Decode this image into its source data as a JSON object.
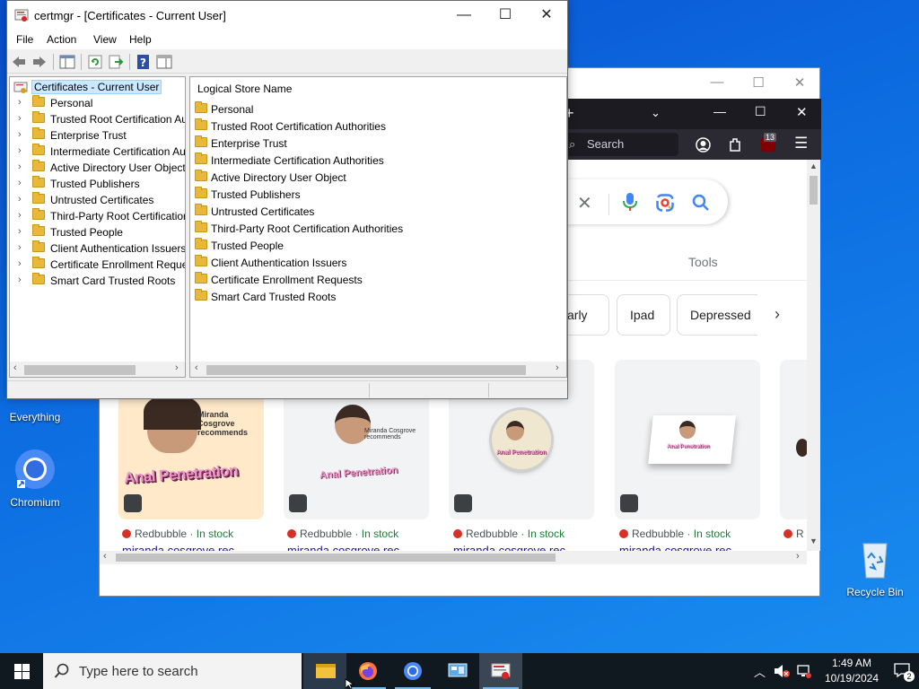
{
  "colors": {
    "desktop": "#0c6be0",
    "taskbar": "#101820",
    "selection": "#cce8ff",
    "folder": "#e8b83a"
  },
  "desktop": {
    "icons": [
      {
        "label": "Everything"
      },
      {
        "label": "Chromium"
      },
      {
        "label": "Recycle Bin"
      }
    ]
  },
  "browser": {
    "search_label": "Search",
    "badge_count": "13",
    "tools_label": "Tools",
    "chips": [
      "carly",
      "Ipad",
      "Depressed"
    ],
    "results": [
      {
        "caption": "Miranda Cosgrove recommends",
        "source": "Redbubble",
        "stock": "· In stock",
        "line": "miranda cosgrove rec"
      },
      {
        "caption": "Miranda Cosgrove recommends",
        "source": "Redbubble",
        "stock": "· In stock",
        "line": "miranda cosgrove rec"
      },
      {
        "caption": "",
        "source": "Redbubble",
        "stock": "· In stock",
        "line": "miranda cosgrove rec"
      },
      {
        "caption": "",
        "source": "Redbubble",
        "stock": "· In stock",
        "line": "miranda cosgrove rec"
      },
      {
        "caption": "",
        "source": "R",
        "stock": "",
        "line": ""
      }
    ],
    "banner_text": "Anal Penetration"
  },
  "certmgr": {
    "title": "certmgr - [Certificates - Current User]",
    "menu": [
      "File",
      "Action",
      "View",
      "Help"
    ],
    "tree_root": "Certificates - Current User",
    "tree_items": [
      "Personal",
      "Trusted Root Certification Au",
      "Enterprise Trust",
      "Intermediate Certification Au",
      "Active Directory User Object",
      "Trusted Publishers",
      "Untrusted Certificates",
      "Third-Party Root Certificatior",
      "Trusted People",
      "Client Authentication Issuers",
      "Certificate Enrollment Reques",
      "Smart Card Trusted Roots"
    ],
    "list_header": "Logical Store Name",
    "list_items": [
      "Personal",
      "Trusted Root Certification Authorities",
      "Enterprise Trust",
      "Intermediate Certification Authorities",
      "Active Directory User Object",
      "Trusted Publishers",
      "Untrusted Certificates",
      "Third-Party Root Certification Authorities",
      "Trusted People",
      "Client Authentication Issuers",
      "Certificate Enrollment Requests",
      "Smart Card Trusted Roots"
    ]
  },
  "taskbar": {
    "search_placeholder": "Type here to search",
    "time": "1:49 AM",
    "date": "10/19/2024",
    "notification_count": "2"
  }
}
